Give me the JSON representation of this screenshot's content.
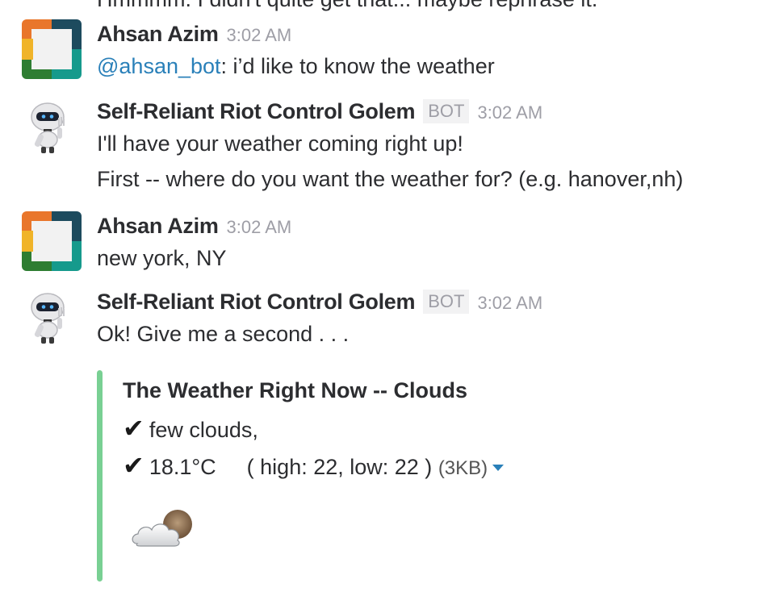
{
  "cut_off_text": "Hmmmm. I didn't quite get that... maybe rephrase it.",
  "messages": [
    {
      "sender": "Ahsan Azim",
      "time": "3:02 AM",
      "mention": "@ahsan_bot",
      "text": ": i’d like to know the weather"
    },
    {
      "sender": "Self-Reliant Riot Control Golem",
      "badge": "BOT",
      "time": "3:02 AM",
      "lines": [
        "I'll have your weather coming right up!",
        "First -- where do you want the weather for? (e.g. hanover,nh)"
      ]
    },
    {
      "sender": "Ahsan Azim",
      "time": "3:02 AM",
      "text": "new york, NY"
    },
    {
      "sender": "Self-Reliant Riot Control Golem",
      "badge": "BOT",
      "time": "3:02 AM",
      "text": "Ok! Give me a second . . ."
    }
  ],
  "attachment": {
    "title": "The Weather Right Now -- Clouds",
    "check": "✔",
    "line1": "few clouds,",
    "temp": "18.1°C",
    "range": "( high: 22, low: 22 )",
    "size": "(3KB)",
    "icon": "partly-cloudy-icon",
    "bar_color": "#79d093"
  },
  "colors": {
    "mention": "#2a80b9",
    "timestamp": "#9e9ea6"
  }
}
